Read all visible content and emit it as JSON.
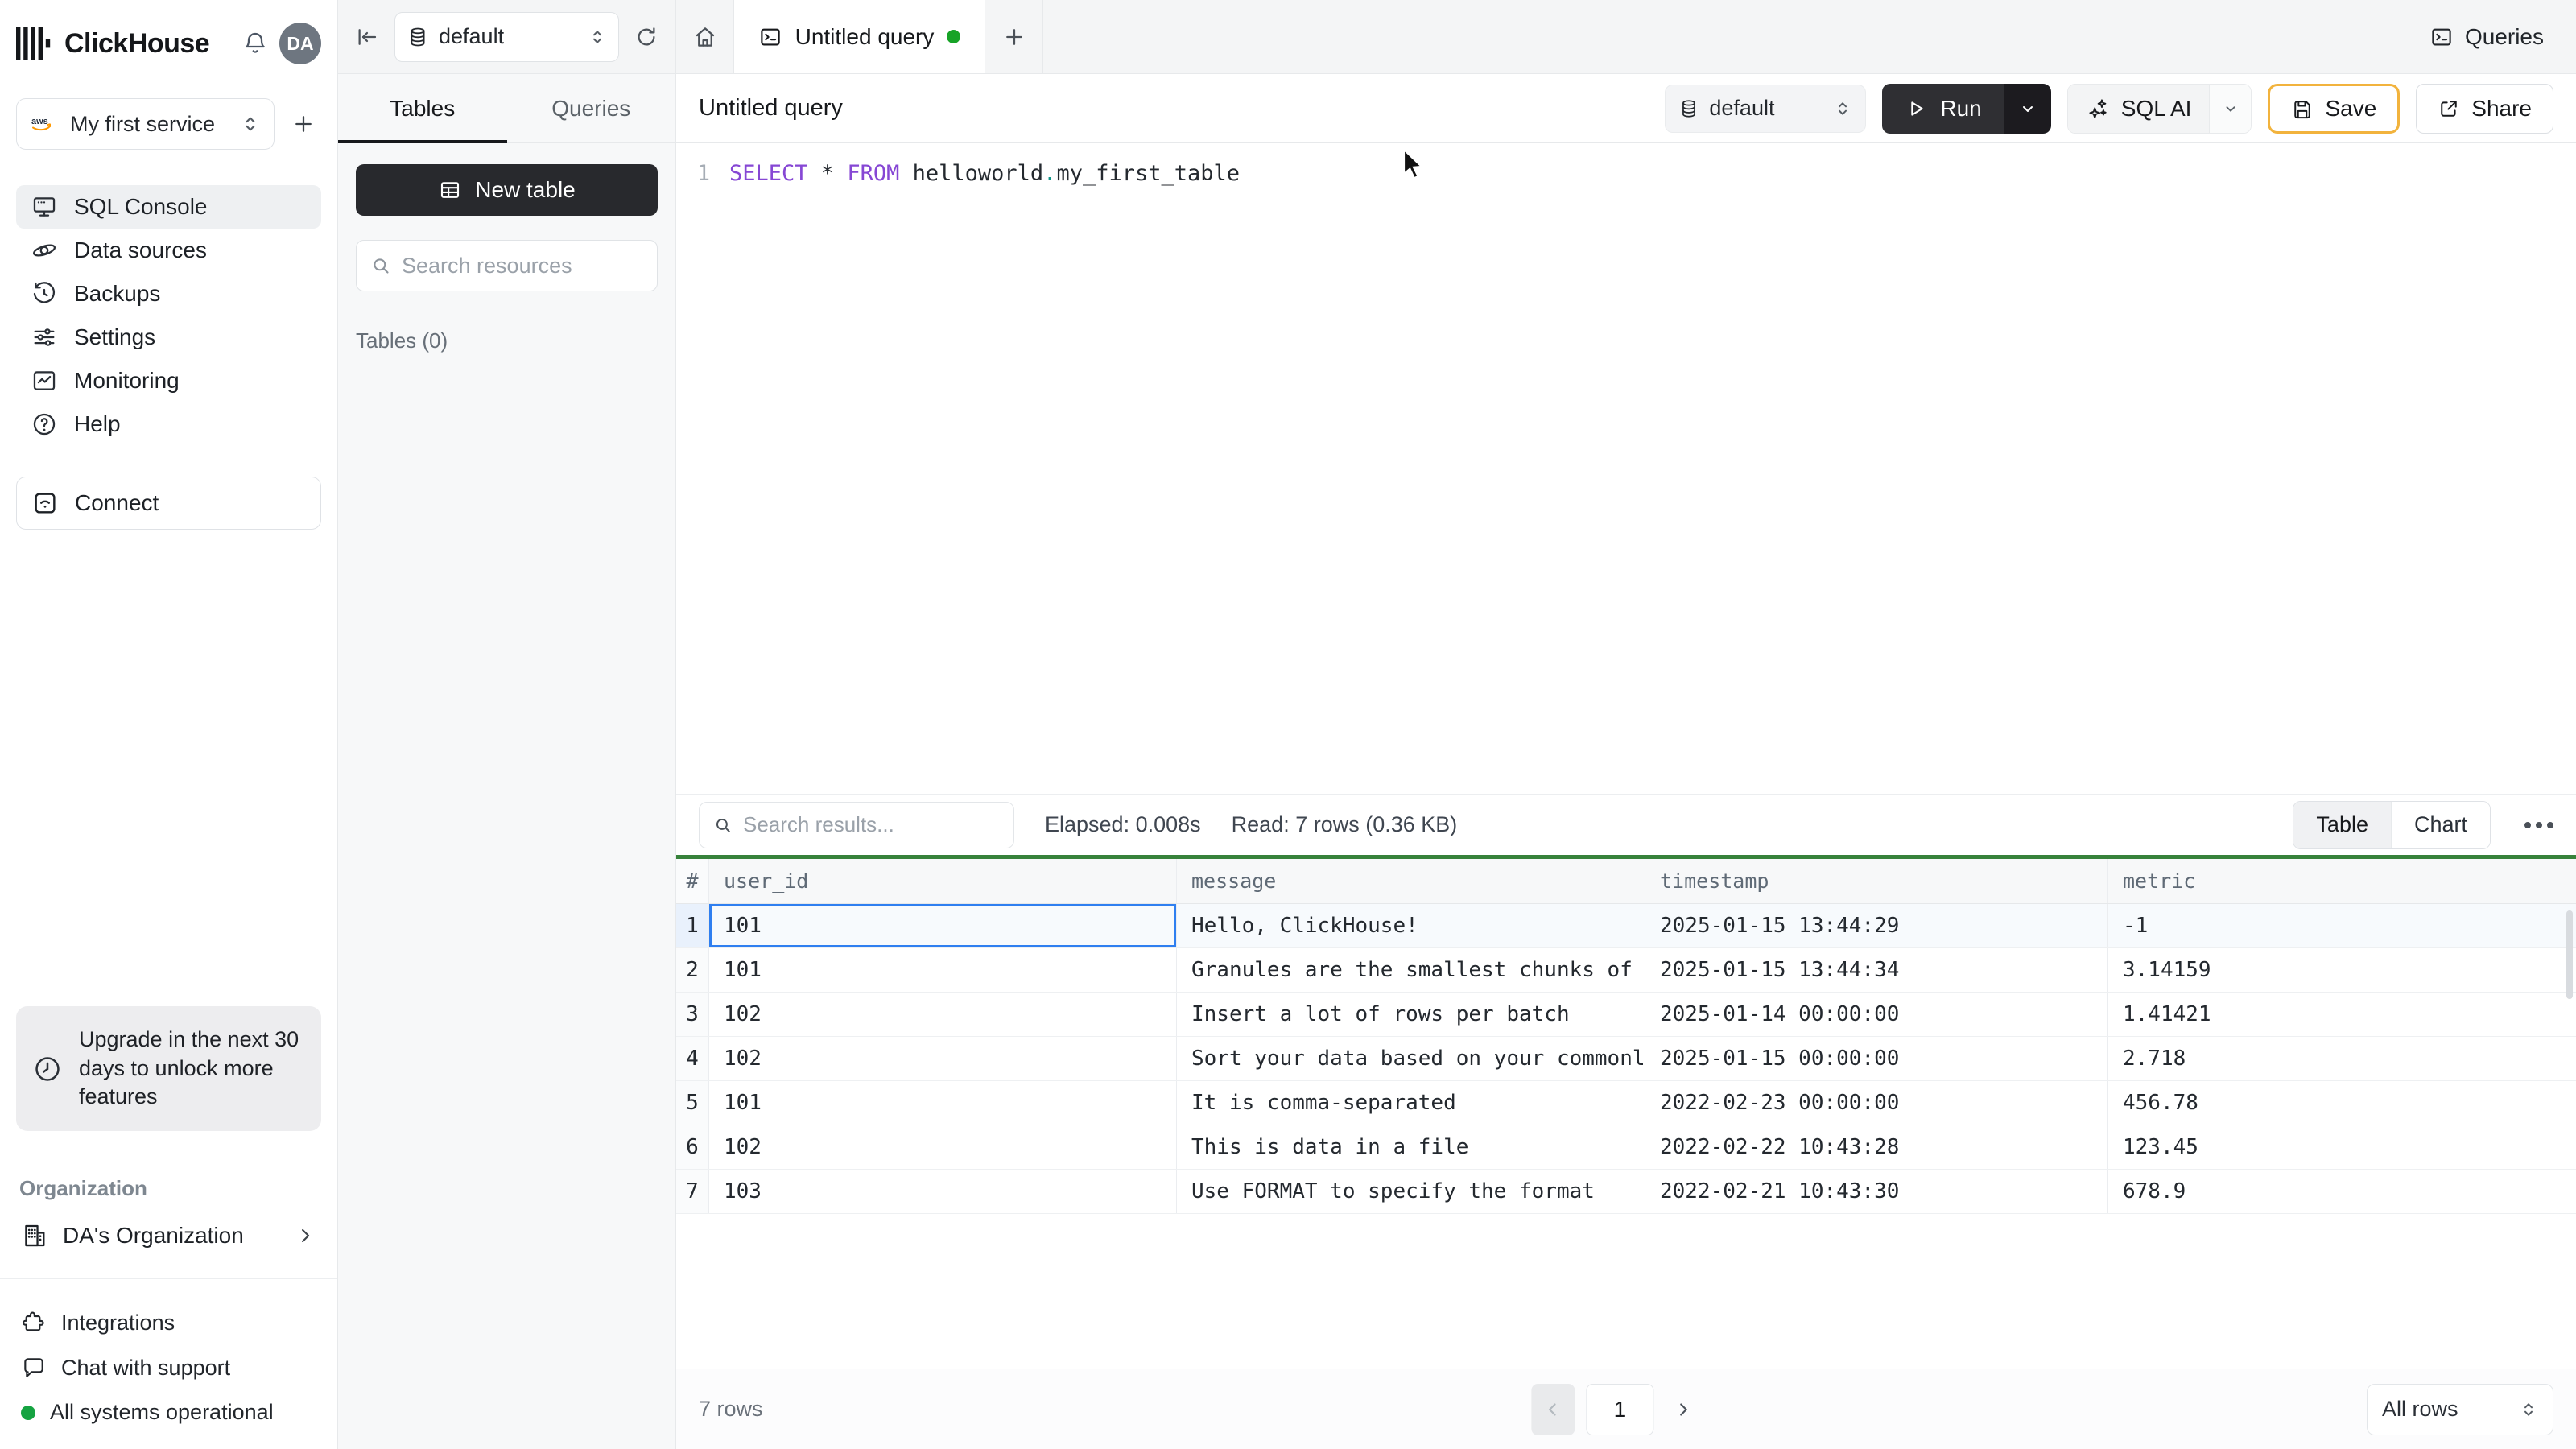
{
  "colors": {
    "table_top_bar_green": "#37823b",
    "unsaved_dot_green": "#17a327",
    "status_dot_green": "#15a341",
    "save_button_border_orange": "#f2b33d",
    "selected_cell_blue": "#2f7ff0",
    "sql_keyword_purple": "#8647d4",
    "sql_punct_teal": "#0d9488"
  },
  "app": {
    "name": "ClickHouse"
  },
  "topbar": {
    "avatar_initials": "DA",
    "queries_button": "Queries"
  },
  "sidebar": {
    "service_selector": {
      "label": "My first service",
      "provider_icon": "aws-icon"
    },
    "nav_items": [
      {
        "label": "SQL Console",
        "icon": "console-icon",
        "active": true
      },
      {
        "label": "Data sources",
        "icon": "data-sources-icon",
        "active": false
      },
      {
        "label": "Backups",
        "icon": "backups-icon",
        "active": false
      },
      {
        "label": "Settings",
        "icon": "settings-icon",
        "active": false
      },
      {
        "label": "Monitoring",
        "icon": "monitoring-icon",
        "active": false
      },
      {
        "label": "Help",
        "icon": "help-icon",
        "active": false
      }
    ],
    "connect_button": "Connect",
    "upgrade_notice": "Upgrade in the next 30 days to unlock more features",
    "organization_section": "Organization",
    "organization_name": "DA's Organization",
    "footer_items": [
      {
        "label": "Integrations",
        "icon": "integrations-icon"
      },
      {
        "label": "Chat with support",
        "icon": "chat-icon"
      },
      {
        "label": "All systems operational",
        "icon": "status-dot-green"
      }
    ]
  },
  "tables_panel": {
    "database_selector": "default",
    "tabs": [
      {
        "label": "Tables",
        "active": true
      },
      {
        "label": "Queries",
        "active": false
      }
    ],
    "new_table_button": "New table",
    "search_placeholder": "Search resources",
    "tables_count": "Tables (0)"
  },
  "tab_bar": {
    "active_tab_label": "Untitled query",
    "unsaved": true
  },
  "query_header": {
    "title": "Untitled query",
    "database_selector": "default",
    "run_button": "Run",
    "sql_ai_button": "SQL AI",
    "save_button": "Save",
    "share_button": "Share"
  },
  "editor": {
    "line_number": "1",
    "sql_tokens": [
      {
        "text": "SELECT",
        "type": "keyword"
      },
      {
        "text": " * ",
        "type": "plain"
      },
      {
        "text": "FROM",
        "type": "keyword"
      },
      {
        "text": " helloworld",
        "type": "plain"
      },
      {
        "text": ".",
        "type": "punct"
      },
      {
        "text": "my_first_table",
        "type": "plain"
      }
    ]
  },
  "results": {
    "search_placeholder": "Search results...",
    "elapsed": "Elapsed: 0.008s",
    "read": "Read: 7 rows (0.36 KB)",
    "view_tabs": [
      {
        "label": "Table",
        "active": true
      },
      {
        "label": "Chart",
        "active": false
      }
    ],
    "table": {
      "row_number_header": "#",
      "columns": [
        "user_id",
        "message",
        "timestamp",
        "metric"
      ],
      "rows": [
        {
          "n": "1",
          "user_id": "101",
          "message": "Hello, ClickHouse!",
          "timestamp": "2025-01-15 13:44:29",
          "metric": "-1"
        },
        {
          "n": "2",
          "user_id": "101",
          "message": "Granules are the smallest chunks of data read",
          "timestamp": "2025-01-15 13:44:34",
          "metric": "3.14159"
        },
        {
          "n": "3",
          "user_id": "102",
          "message": "Insert a lot of rows per batch",
          "timestamp": "2025-01-14 00:00:00",
          "metric": "1.41421"
        },
        {
          "n": "4",
          "user_id": "102",
          "message": "Sort your data based on your commonly-used que…",
          "timestamp": "2025-01-15 00:00:00",
          "metric": "2.718"
        },
        {
          "n": "5",
          "user_id": "101",
          "message": "It is comma-separated",
          "timestamp": "2022-02-23 00:00:00",
          "metric": "456.78"
        },
        {
          "n": "6",
          "user_id": "102",
          "message": "This is data in a file",
          "timestamp": "2022-02-22 10:43:28",
          "metric": "123.45"
        },
        {
          "n": "7",
          "user_id": "103",
          "message": "Use FORMAT to specify the format",
          "timestamp": "2022-02-21 10:43:30",
          "metric": "678.9"
        }
      ],
      "selected_cell": {
        "row_index": 0,
        "column": "user_id"
      }
    },
    "footer": {
      "row_count": "7 rows",
      "current_page": "1",
      "rows_per_page": "All rows"
    }
  }
}
